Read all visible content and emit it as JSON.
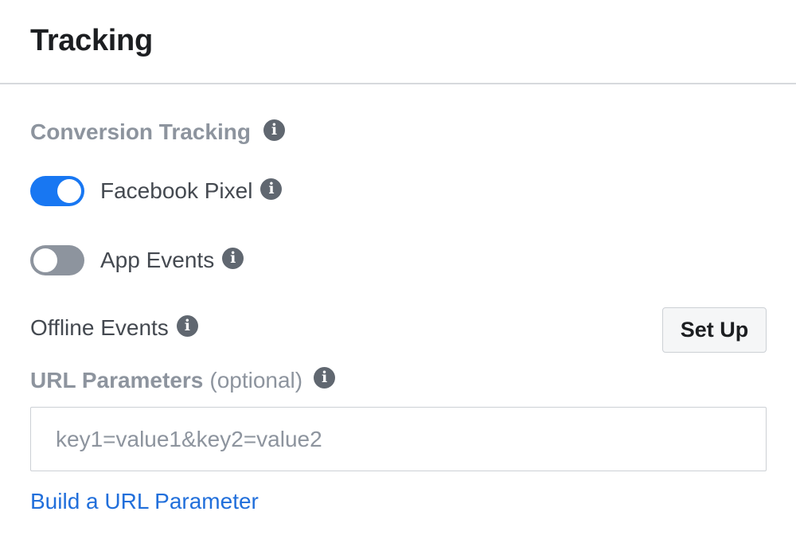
{
  "header": {
    "title": "Tracking"
  },
  "conversion_tracking": {
    "label": "Conversion Tracking",
    "info_icon": "info-icon"
  },
  "toggles": [
    {
      "label": "Facebook Pixel",
      "state": "on"
    },
    {
      "label": "App Events",
      "state": "off"
    }
  ],
  "offline_events": {
    "label": "Offline Events",
    "button_label": "Set Up"
  },
  "url_parameters": {
    "label": "URL Parameters",
    "optional": "(optional)",
    "placeholder": "key1=value1&key2=value2",
    "value": ""
  },
  "build_link": {
    "label": "Build a URL Parameter"
  },
  "colors": {
    "accent": "#1877f2",
    "link": "#216fdb",
    "toggle_off": "#8d949e",
    "muted_text": "#8d949e"
  }
}
